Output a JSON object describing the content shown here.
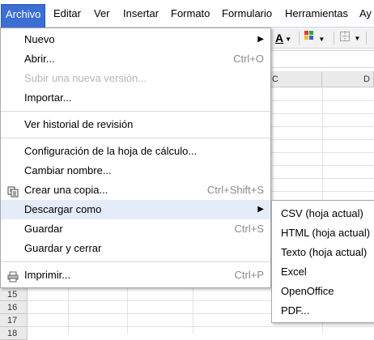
{
  "menubar": {
    "items": [
      "Archivo",
      "Editar",
      "Ver",
      "Insertar",
      "Formato",
      "Formulario",
      "Herramientas",
      "Ay"
    ]
  },
  "toolbar": {
    "text_color_glyph": "A",
    "text_color_icon": "text-color-icon",
    "fill_color_icon": "fill-color-icon",
    "borders_icon": "borders-icon",
    "colors": {
      "accent": "#3b6fd4",
      "highlight": "#e5ecf9"
    }
  },
  "grid": {
    "columns": [
      "C",
      "D"
    ],
    "rows": [
      "15",
      "16",
      "17",
      "18"
    ]
  },
  "menu": {
    "items": [
      {
        "label": "Nuevo",
        "shortcut": "",
        "submenu": true
      },
      {
        "label": "Abrir...",
        "shortcut": "Ctrl+O"
      },
      {
        "label": "Subir una nueva versión...",
        "shortcut": "",
        "disabled": true
      },
      {
        "label": "Importar...",
        "shortcut": ""
      },
      {
        "label": "Ver historial de revisión",
        "shortcut": ""
      },
      {
        "label": "Configuración de la hoja de cálculo...",
        "shortcut": ""
      },
      {
        "label": "Cambiar nombre...",
        "shortcut": ""
      },
      {
        "label": "Crear una copia...",
        "shortcut": "Ctrl+Shift+S",
        "icon": "copy-icon"
      },
      {
        "label": "Descargar como",
        "shortcut": "",
        "submenu": true,
        "highlighted": true
      },
      {
        "label": "Guardar",
        "shortcut": "Ctrl+S"
      },
      {
        "label": "Guardar y cerrar",
        "shortcut": ""
      },
      {
        "label": "Imprimir...",
        "shortcut": "Ctrl+P",
        "icon": "printer-icon"
      }
    ]
  },
  "submenu": {
    "items": [
      "CSV (hoja actual)",
      "HTML (hoja actual)",
      "Texto (hoja actual)",
      "Excel",
      "OpenOffice",
      "PDF..."
    ]
  }
}
